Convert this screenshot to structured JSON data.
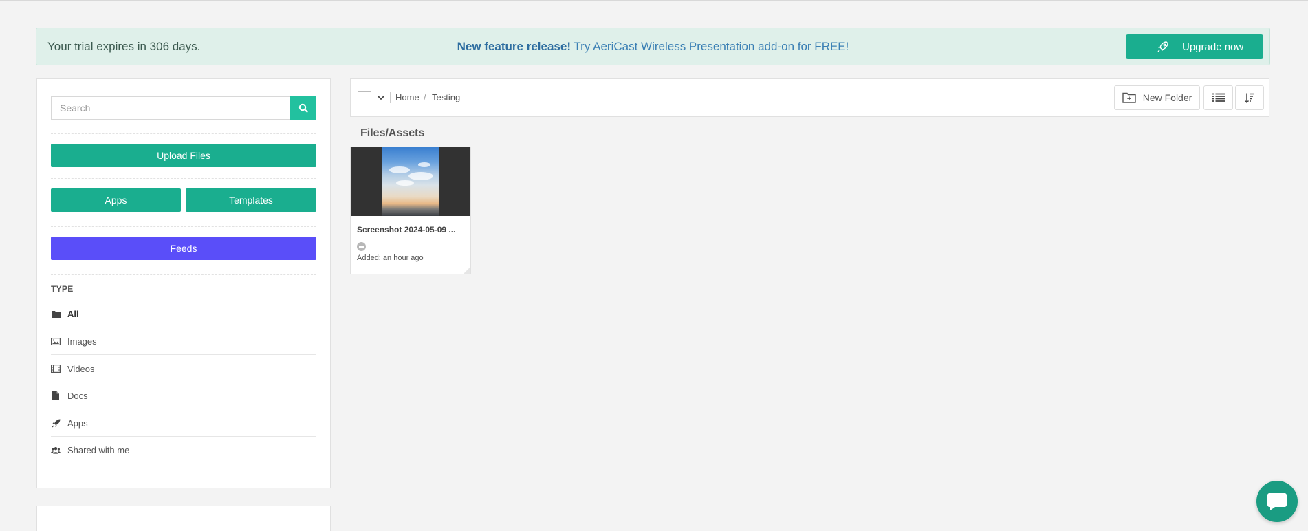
{
  "banner": {
    "trial_text": "Your trial expires in 306 days.",
    "feature_bold": "New feature release!",
    "feature_text": " Try AeriCast Wireless Presentation add-on for FREE!",
    "upgrade_label": "Upgrade now",
    "upgrade_icon": "rocket-icon"
  },
  "sidebar": {
    "search_placeholder": "Search",
    "upload_label": "Upload Files",
    "apps_label": "Apps",
    "templates_label": "Templates",
    "feeds_label": "Feeds",
    "type_heading": "TYPE",
    "types": [
      {
        "label": "All",
        "icon": "folder-icon",
        "active": true
      },
      {
        "label": "Images",
        "icon": "image-icon"
      },
      {
        "label": "Videos",
        "icon": "film-icon"
      },
      {
        "label": "Docs",
        "icon": "document-icon"
      },
      {
        "label": "Apps",
        "icon": "rocket-icon"
      },
      {
        "label": "Shared with me",
        "icon": "users-icon"
      }
    ]
  },
  "toolbar": {
    "breadcrumb_home": "Home",
    "breadcrumb_sep": "/",
    "breadcrumb_current": "Testing",
    "new_folder_label": "New Folder"
  },
  "main": {
    "section_title": "Files/Assets",
    "files": [
      {
        "name": "Screenshot 2024-05-09 ...",
        "added": "Added: an hour ago"
      }
    ]
  },
  "colors": {
    "accent_green": "#1aae8f",
    "feeds_purple": "#5a4ef9",
    "banner_bg": "#dff0ea"
  }
}
